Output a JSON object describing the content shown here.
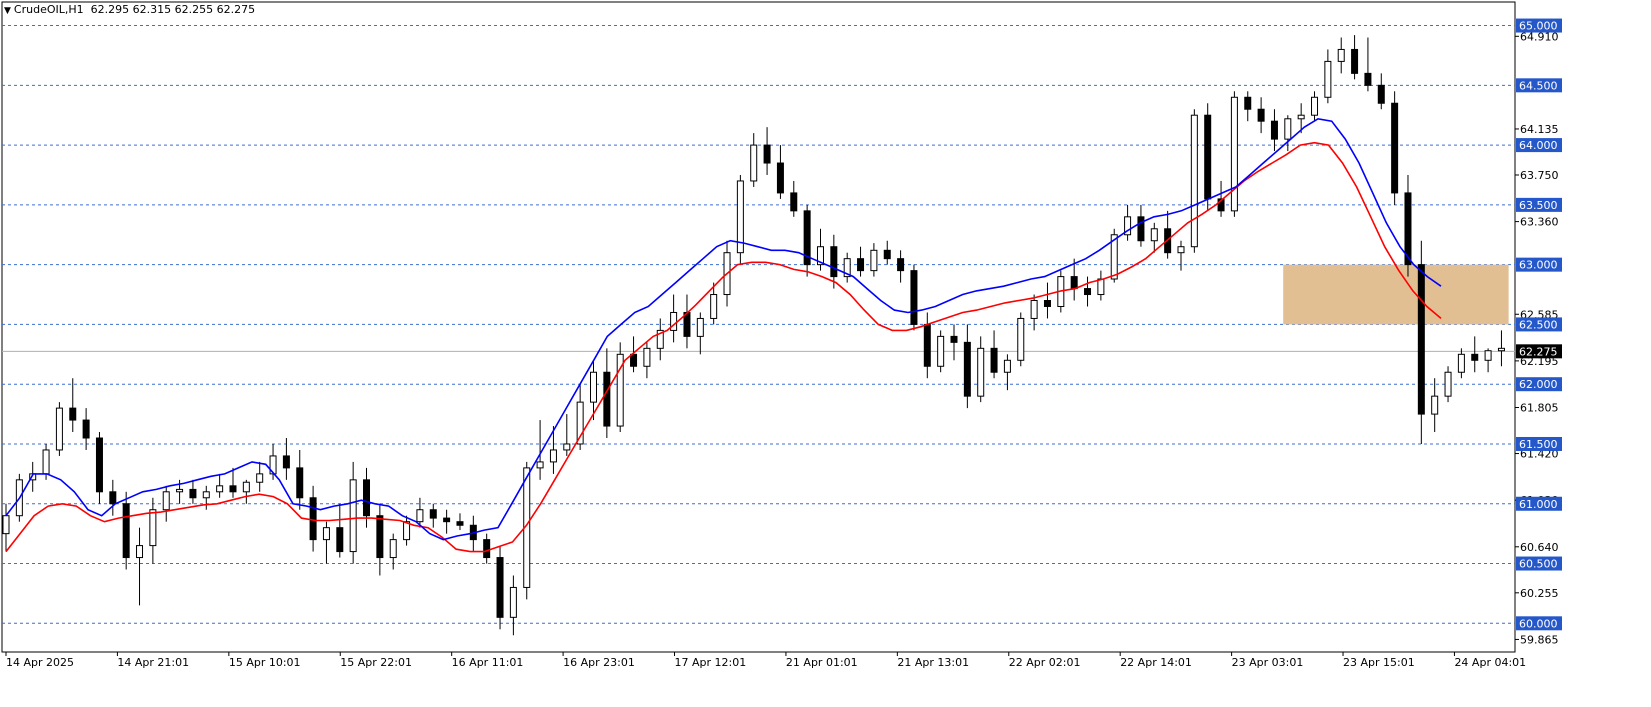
{
  "header": {
    "symbol_timeframe": "CrudeOIL,H1",
    "ohlc": "62.295 62.315 62.255 62.275"
  },
  "chart_data": {
    "type": "candlestick",
    "symbol": "CrudeOIL",
    "timeframe": "H1",
    "ylim": [
      59.76,
      65.13
    ],
    "price_ticks": [
      "64.910",
      "64.135",
      "63.750",
      "63.360",
      "62.585",
      "62.195",
      "61.805",
      "61.420",
      "61.030",
      "60.640",
      "60.255",
      "59.865"
    ],
    "level_lines": [
      65.0,
      64.5,
      64.0,
      63.5,
      63.0,
      62.5,
      62.0,
      61.5,
      61.0,
      60.5,
      60.0
    ],
    "level_labels": [
      "65.000",
      "64.500",
      "64.000",
      "63.500",
      "63.000",
      "62.500",
      "62.000",
      "61.500",
      "61.000",
      "60.500",
      "60.000"
    ],
    "current_price": 62.275,
    "current_price_label": "62.275",
    "time_labels": [
      "14 Apr 2025",
      "14 Apr 21:01",
      "15 Apr 10:01",
      "15 Apr 22:01",
      "16 Apr 11:01",
      "16 Apr 23:01",
      "17 Apr 12:01",
      "21 Apr 01:01",
      "21 Apr 13:01",
      "22 Apr 02:01",
      "22 Apr 14:01",
      "23 Apr 03:01",
      "23 Apr 15:01",
      "24 Apr 04:01"
    ],
    "time_label_bar_index": [
      0,
      13,
      26,
      39,
      52,
      65,
      78,
      91,
      104,
      117,
      130,
      143,
      156,
      169
    ],
    "zone": {
      "from_bar": 156,
      "to_bar": 183,
      "low": 62.5,
      "high": 63.0,
      "color": "#deb887"
    },
    "ma_fast": {
      "color": "#0000ff",
      "period_note": "",
      "values": [
        60.9,
        61.05,
        61.25,
        61.25,
        61.2,
        61.1,
        60.95,
        60.9,
        61.0,
        61.05,
        61.1,
        61.12,
        61.15,
        61.17,
        61.2,
        61.23,
        61.25,
        61.3,
        61.35,
        61.33,
        61.2,
        61.0,
        60.98,
        60.95,
        60.98,
        61.0,
        61.03,
        61.0,
        60.98,
        60.9,
        60.85,
        60.75,
        60.7,
        60.73,
        60.75,
        60.78,
        60.8,
        61.0,
        61.2,
        61.4,
        61.6,
        61.8,
        62.0,
        62.2,
        62.4,
        62.5,
        62.6,
        62.65,
        62.75,
        62.85,
        62.95,
        63.05,
        63.15,
        63.2,
        63.18,
        63.15,
        63.12,
        63.12,
        63.1,
        63.05,
        63.0,
        62.95,
        62.9,
        62.8,
        62.7,
        62.62,
        62.6,
        62.62,
        62.65,
        62.7,
        62.75,
        62.78,
        62.8,
        62.82,
        62.85,
        62.88,
        62.9,
        62.95,
        63.0,
        63.05,
        63.12,
        63.2,
        63.28,
        63.35,
        63.4,
        63.42,
        63.45,
        63.5,
        63.55,
        63.6,
        63.65,
        63.75,
        63.85,
        63.95,
        64.05,
        64.15,
        64.22,
        64.2,
        64.05,
        63.85,
        63.6,
        63.35,
        63.15,
        63.0,
        62.9,
        62.82
      ]
    },
    "ma_slow": {
      "color": "#ff0000",
      "period_note": "",
      "values": [
        60.6,
        60.75,
        60.9,
        60.98,
        61.0,
        60.98,
        60.9,
        60.85,
        60.88,
        60.9,
        60.92,
        60.93,
        60.95,
        60.97,
        60.99,
        61.0,
        61.03,
        61.06,
        61.08,
        61.06,
        61.0,
        60.88,
        60.86,
        60.86,
        60.87,
        60.88,
        60.88,
        60.87,
        60.86,
        60.82,
        60.8,
        60.72,
        60.62,
        60.6,
        60.6,
        60.64,
        60.68,
        60.82,
        61.0,
        61.2,
        61.4,
        61.6,
        61.8,
        62.0,
        62.2,
        62.3,
        62.4,
        62.45,
        62.55,
        62.66,
        62.78,
        62.9,
        63.0,
        63.02,
        63.02,
        63.0,
        62.96,
        62.94,
        62.9,
        62.85,
        62.75,
        62.62,
        62.5,
        62.45,
        62.45,
        62.48,
        62.52,
        62.56,
        62.6,
        62.62,
        62.65,
        62.68,
        62.7,
        62.72,
        62.75,
        62.78,
        62.8,
        62.85,
        62.88,
        62.92,
        62.98,
        63.05,
        63.15,
        63.25,
        63.35,
        63.42,
        63.5,
        63.6,
        63.7,
        63.78,
        63.85,
        63.92,
        64.0,
        64.02,
        64.0,
        63.85,
        63.65,
        63.4,
        63.15,
        62.95,
        62.78,
        62.65,
        62.55
      ]
    },
    "candles": [
      [
        60.75,
        61.0,
        60.6,
        60.9
      ],
      [
        60.9,
        61.25,
        60.85,
        61.2
      ],
      [
        61.2,
        61.35,
        61.1,
        61.25
      ],
      [
        61.25,
        61.5,
        61.2,
        61.45
      ],
      [
        61.45,
        61.85,
        61.4,
        61.8
      ],
      [
        61.8,
        62.05,
        61.6,
        61.7
      ],
      [
        61.7,
        61.8,
        61.45,
        61.55
      ],
      [
        61.55,
        61.6,
        61.0,
        61.1
      ],
      [
        61.1,
        61.2,
        60.9,
        61.0
      ],
      [
        61.0,
        61.1,
        60.45,
        60.55
      ],
      [
        60.55,
        60.8,
        60.15,
        60.65
      ],
      [
        60.65,
        61.05,
        60.5,
        60.95
      ],
      [
        60.95,
        61.15,
        60.85,
        61.1
      ],
      [
        61.1,
        61.2,
        61.0,
        61.12
      ],
      [
        61.12,
        61.2,
        61.0,
        61.05
      ],
      [
        61.05,
        61.15,
        60.95,
        61.1
      ],
      [
        61.1,
        61.25,
        61.05,
        61.15
      ],
      [
        61.15,
        61.3,
        61.05,
        61.1
      ],
      [
        61.1,
        61.2,
        61.0,
        61.18
      ],
      [
        61.18,
        61.35,
        61.1,
        61.25
      ],
      [
        61.25,
        61.5,
        61.2,
        61.4
      ],
      [
        61.4,
        61.55,
        61.2,
        61.3
      ],
      [
        61.3,
        61.45,
        60.95,
        61.05
      ],
      [
        61.05,
        61.15,
        60.6,
        60.7
      ],
      [
        60.7,
        60.85,
        60.5,
        60.8
      ],
      [
        60.8,
        61.0,
        60.55,
        60.6
      ],
      [
        60.6,
        61.35,
        60.5,
        61.2
      ],
      [
        61.2,
        61.3,
        60.8,
        60.9
      ],
      [
        60.9,
        61.0,
        60.4,
        60.55
      ],
      [
        60.55,
        60.75,
        60.45,
        60.7
      ],
      [
        60.7,
        60.9,
        60.65,
        60.85
      ],
      [
        60.85,
        61.05,
        60.8,
        60.95
      ],
      [
        60.95,
        61.0,
        60.8,
        60.88
      ],
      [
        60.88,
        60.95,
        60.75,
        60.85
      ],
      [
        60.85,
        60.92,
        60.78,
        60.82
      ],
      [
        60.82,
        60.9,
        60.6,
        60.7
      ],
      [
        60.7,
        60.75,
        60.5,
        60.55
      ],
      [
        60.55,
        60.65,
        59.95,
        60.05
      ],
      [
        60.05,
        60.4,
        59.9,
        60.3
      ],
      [
        60.3,
        61.35,
        60.2,
        61.3
      ],
      [
        61.3,
        61.7,
        61.2,
        61.35
      ],
      [
        61.35,
        61.65,
        61.25,
        61.45
      ],
      [
        61.45,
        61.75,
        61.4,
        61.5
      ],
      [
        61.5,
        62.0,
        61.45,
        61.85
      ],
      [
        61.85,
        62.2,
        61.7,
        62.1
      ],
      [
        62.1,
        62.3,
        61.55,
        61.65
      ],
      [
        61.65,
        62.35,
        61.6,
        62.25
      ],
      [
        62.25,
        62.4,
        62.1,
        62.15
      ],
      [
        62.15,
        62.35,
        62.05,
        62.3
      ],
      [
        62.3,
        62.55,
        62.2,
        62.45
      ],
      [
        62.45,
        62.75,
        62.35,
        62.6
      ],
      [
        62.6,
        62.75,
        62.3,
        62.4
      ],
      [
        62.4,
        62.6,
        62.25,
        62.55
      ],
      [
        62.55,
        62.85,
        62.5,
        62.75
      ],
      [
        62.75,
        63.2,
        62.65,
        63.1
      ],
      [
        63.1,
        63.75,
        63.0,
        63.7
      ],
      [
        63.7,
        64.1,
        63.65,
        64.0
      ],
      [
        64.0,
        64.15,
        63.75,
        63.85
      ],
      [
        63.85,
        64.0,
        63.55,
        63.6
      ],
      [
        63.6,
        63.7,
        63.4,
        63.45
      ],
      [
        63.45,
        63.5,
        62.9,
        63.0
      ],
      [
        63.0,
        63.3,
        62.95,
        63.15
      ],
      [
        63.15,
        63.25,
        62.8,
        62.9
      ],
      [
        62.9,
        63.1,
        62.85,
        63.05
      ],
      [
        63.05,
        63.15,
        62.9,
        62.95
      ],
      [
        62.95,
        63.18,
        62.9,
        63.12
      ],
      [
        63.12,
        63.2,
        63.0,
        63.05
      ],
      [
        63.05,
        63.12,
        62.85,
        62.95
      ],
      [
        62.95,
        63.0,
        62.45,
        62.5
      ],
      [
        62.5,
        62.6,
        62.05,
        62.15
      ],
      [
        62.15,
        62.45,
        62.1,
        62.4
      ],
      [
        62.4,
        62.5,
        62.2,
        62.35
      ],
      [
        62.35,
        62.5,
        61.8,
        61.9
      ],
      [
        61.9,
        62.4,
        61.85,
        62.3
      ],
      [
        62.3,
        62.45,
        62.05,
        62.1
      ],
      [
        62.1,
        62.25,
        61.95,
        62.2
      ],
      [
        62.2,
        62.6,
        62.15,
        62.55
      ],
      [
        62.55,
        62.75,
        62.45,
        62.7
      ],
      [
        62.7,
        62.85,
        62.55,
        62.65
      ],
      [
        62.65,
        62.95,
        62.6,
        62.9
      ],
      [
        62.9,
        63.05,
        62.7,
        62.8
      ],
      [
        62.8,
        62.9,
        62.65,
        62.75
      ],
      [
        62.75,
        62.95,
        62.7,
        62.88
      ],
      [
        62.88,
        63.3,
        62.85,
        63.25
      ],
      [
        63.25,
        63.5,
        63.2,
        63.4
      ],
      [
        63.4,
        63.5,
        63.15,
        63.2
      ],
      [
        63.2,
        63.35,
        63.1,
        63.3
      ],
      [
        63.3,
        63.45,
        63.05,
        63.1
      ],
      [
        63.1,
        63.2,
        62.95,
        63.15
      ],
      [
        63.15,
        64.3,
        63.1,
        64.25
      ],
      [
        64.25,
        64.35,
        63.45,
        63.55
      ],
      [
        63.55,
        63.7,
        63.4,
        63.45
      ],
      [
        63.45,
        64.45,
        63.4,
        64.4
      ],
      [
        64.4,
        64.45,
        64.2,
        64.3
      ],
      [
        64.3,
        64.4,
        64.1,
        64.2
      ],
      [
        64.2,
        64.3,
        63.95,
        64.05
      ],
      [
        64.05,
        64.25,
        63.95,
        64.22
      ],
      [
        64.22,
        64.35,
        64.1,
        64.25
      ],
      [
        64.25,
        64.45,
        64.2,
        64.4
      ],
      [
        64.4,
        64.8,
        64.35,
        64.7
      ],
      [
        64.7,
        64.9,
        64.6,
        64.8
      ],
      [
        64.8,
        64.92,
        64.55,
        64.6
      ],
      [
        64.6,
        64.9,
        64.45,
        64.5
      ],
      [
        64.5,
        64.6,
        64.3,
        64.35
      ],
      [
        64.35,
        64.45,
        63.5,
        63.6
      ],
      [
        63.6,
        63.75,
        62.9,
        63.0
      ],
      [
        63.0,
        63.2,
        61.5,
        61.75
      ],
      [
        61.75,
        62.05,
        61.6,
        61.9
      ],
      [
        61.9,
        62.15,
        61.85,
        62.1
      ],
      [
        62.1,
        62.3,
        62.05,
        62.25
      ],
      [
        62.25,
        62.4,
        62.1,
        62.2
      ],
      [
        62.2,
        62.3,
        62.1,
        62.28
      ],
      [
        62.28,
        62.45,
        62.15,
        62.3
      ]
    ]
  },
  "colors": {
    "background": "#ffffff",
    "grid_dash": "#3d6fd0",
    "axis": "#000000",
    "candle_outline": "#000000",
    "bull_fill": "#ffffff",
    "bear_fill": "#000000",
    "badge": "#2457c9",
    "current_badge": "#000000"
  }
}
